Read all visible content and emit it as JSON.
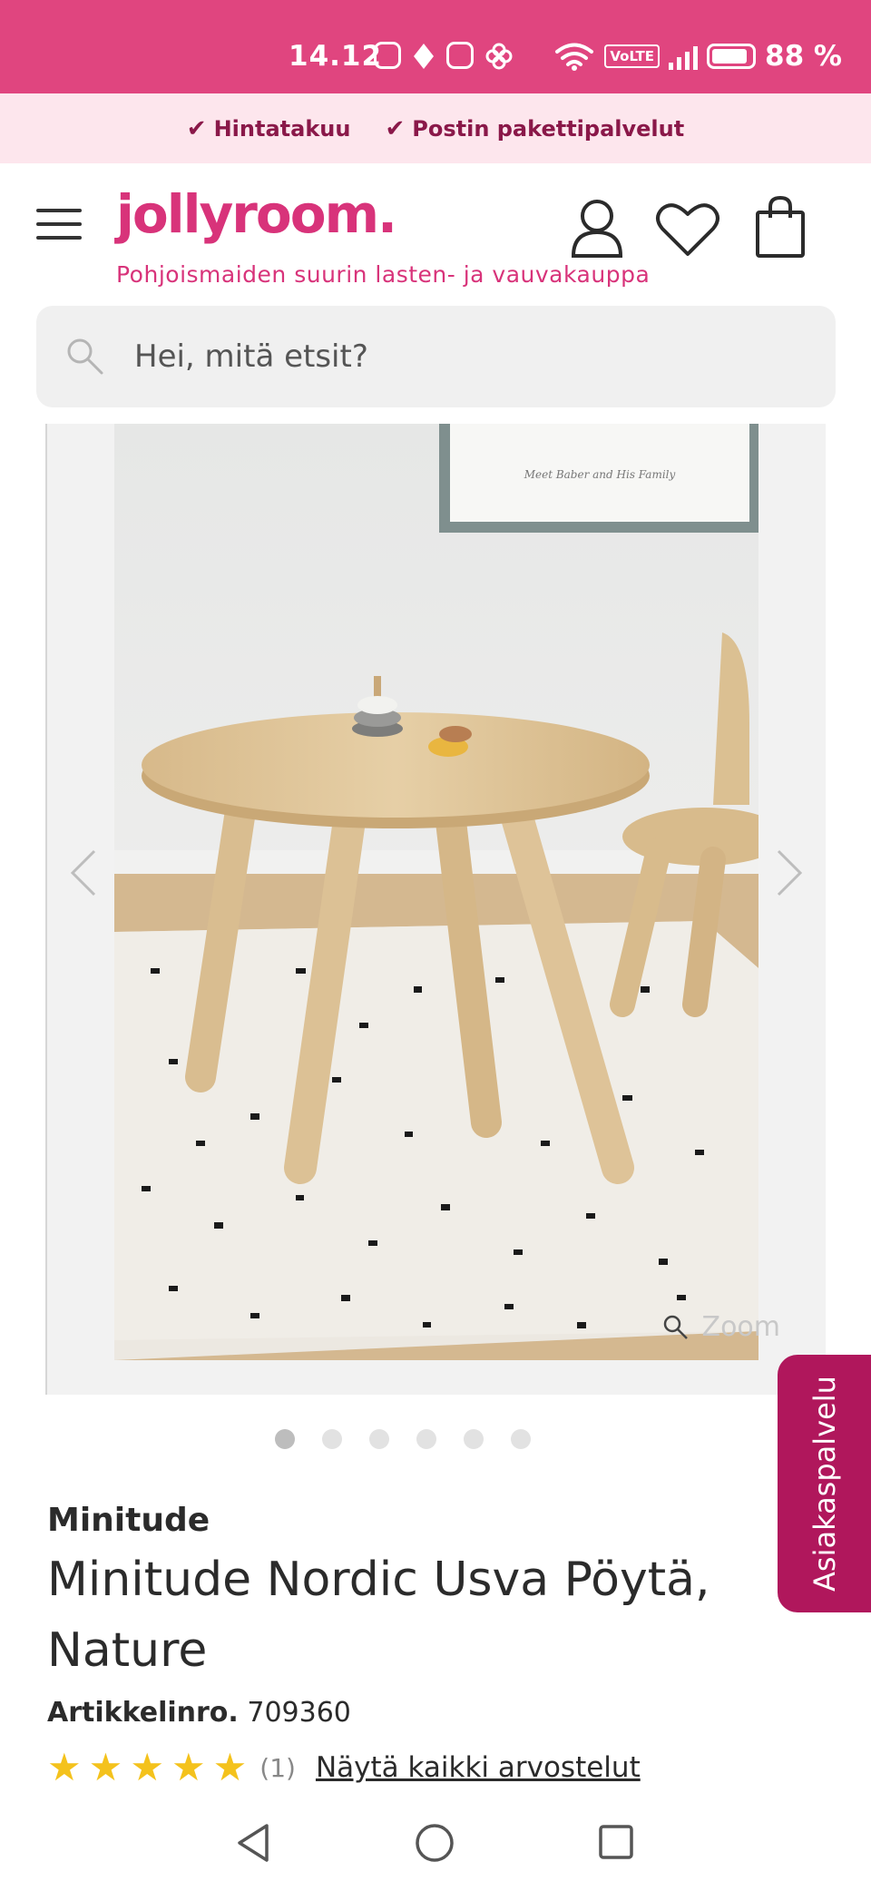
{
  "status_bar": {
    "time": "14.12",
    "volte": "VoLTE",
    "battery": "88 %"
  },
  "promo": {
    "items": [
      "Hintatakuu",
      "Postin pakettipalvelut"
    ]
  },
  "header": {
    "logo": "jollyroom.",
    "tagline": "Pohjoismaiden suurin lasten- ja vauvakauppa"
  },
  "search": {
    "placeholder": "Hei, mitä etsit?"
  },
  "gallery": {
    "zoom_label": "Zoom",
    "poster_caption": "Meet Baber and His Family",
    "image_count": 6,
    "active_index": 0
  },
  "product": {
    "brand": "Minitude",
    "title": "Minitude Nordic Usva Pöytä, Nature",
    "article_label": "Artikkelinro.",
    "article_number": "709360",
    "rating_stars": 5,
    "rating_count": "(1)",
    "reviews_link": "Näytä kaikki arvostelut"
  },
  "customer_service": {
    "label": "Asiakaspalvelu"
  },
  "colors": {
    "brand_pink": "#d8337a",
    "status_bar": "#e0457f",
    "promo_bg": "#fde6ed",
    "cs_tab": "#b0175c",
    "star": "#f4c21c"
  }
}
